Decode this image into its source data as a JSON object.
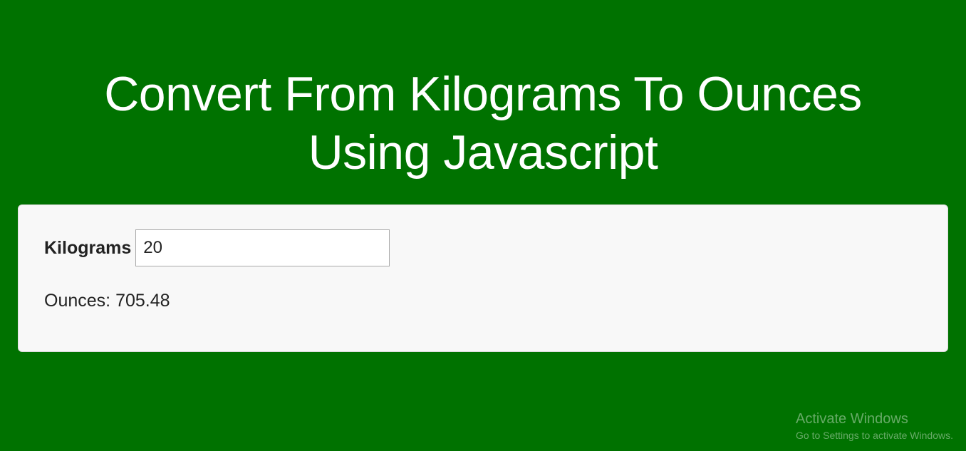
{
  "header": {
    "title_line1": "Convert From Kilograms To Ounces",
    "title_line2": "Using Javascript"
  },
  "form": {
    "input_label": "Kilograms",
    "input_value": "20",
    "output_label": "Ounces:",
    "output_value": "705.48"
  },
  "watermark": {
    "title": "Activate Windows",
    "subtitle": "Go to Settings to activate Windows."
  }
}
